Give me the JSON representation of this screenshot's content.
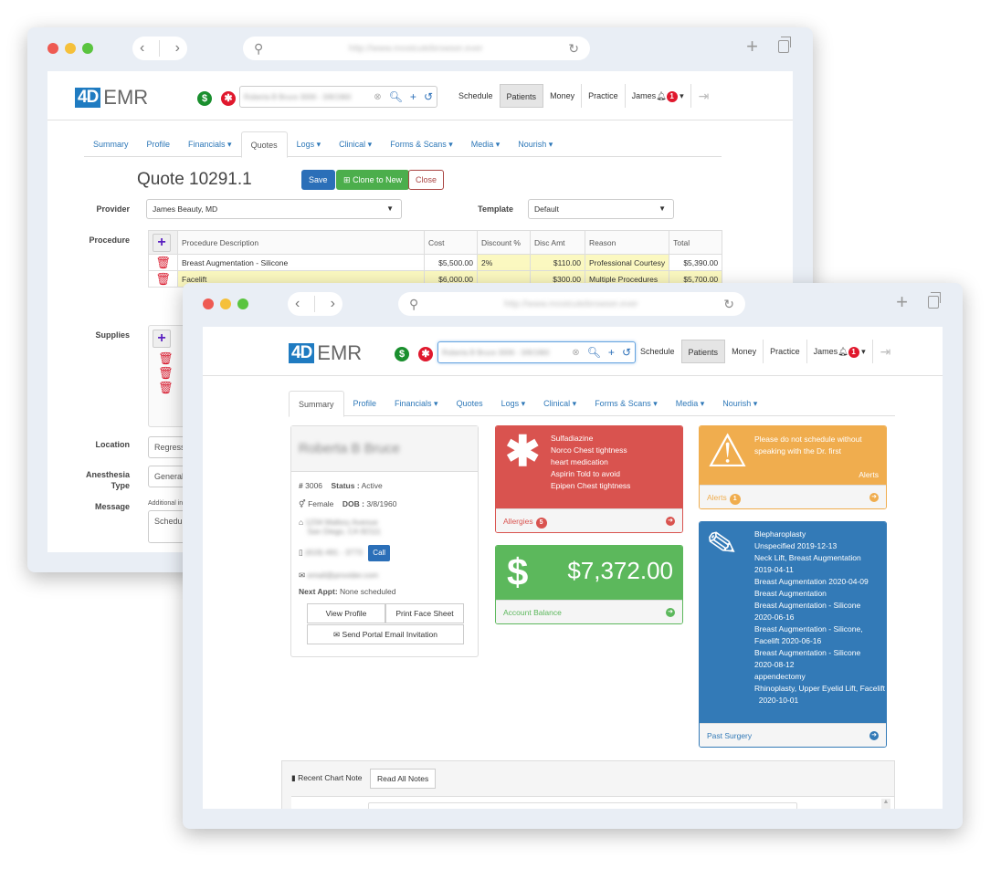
{
  "browser": {
    "url_placeholder": "http://www.mostcutebrowser.ever",
    "back_label": "‹",
    "forward_label": "›"
  },
  "app": {
    "logo_mark": "4D",
    "logo_text": "EMR",
    "money_icon": "$",
    "medical_icon": "✱",
    "search_value": "Roberta B Bruce 3006 - 3/8/1960",
    "nav": [
      "Schedule",
      "Patients",
      "Money",
      "Practice"
    ],
    "active_nav": "Patients",
    "user": "James",
    "notification_count": "1"
  },
  "patient_tabs": [
    "Summary",
    "Profile",
    "Financials ▾",
    "Quotes",
    "Logs ▾",
    "Clinical ▾",
    "Forms & Scans ▾",
    "Media ▾",
    "Nourish ▾"
  ],
  "quote": {
    "title": "Quote 10291.1",
    "save_label": "Save",
    "clone_label": "Clone to New",
    "close_label": "Close",
    "provider_label": "Provider",
    "provider_value": "James Beauty, MD",
    "template_label": "Template",
    "template_value": "Default",
    "procedure_label": "Procedure",
    "columns": [
      "Procedure Description",
      "Cost",
      "Discount %",
      "Disc Amt",
      "Reason",
      "Total"
    ],
    "rows": [
      {
        "description": "Breast Augmentation - Silicone",
        "cost": "$5,500.00",
        "discount_pct": "2%",
        "disc_amt": "$110.00",
        "reason": "Professional Courtesy",
        "total": "$5,390.00"
      },
      {
        "description": "Facelift",
        "cost": "$6,000.00",
        "discount_pct": "",
        "disc_amt": "$300.00",
        "reason": "Multiple Procedures",
        "total": "$5,700.00"
      }
    ],
    "supplies_label": "Supplies",
    "location_label": "Location",
    "location_value": "Regression",
    "anesthesia_label": "Anesthesia Type",
    "anesthesia_value": "General",
    "message_label": "Message",
    "message_hint": "Additional info",
    "message_value": "Schedule"
  },
  "summary": {
    "patient_name": "Roberta B Bruce",
    "id_label": "#",
    "id_value": "3006",
    "status_label": "Status :",
    "status_value": "Active",
    "gender": "Female",
    "dob_label": "DOB :",
    "dob_value": "3/8/1960",
    "address_line1": "1234 Mallory Avenue",
    "address_line2": "San Diego, CA 92111",
    "phone": "(619) 491 - 3773",
    "call_label": "Call",
    "email": "email@provider.com",
    "next_appt_label": "Next Appt:",
    "next_appt_value": "None scheduled",
    "view_profile_label": "View Profile",
    "print_face_sheet_label": "Print Face Sheet",
    "send_portal_label": "Send Portal Email Invitation"
  },
  "allergies": {
    "lines": [
      "Sulfadiazine",
      "Norco   Chest tightness",
      "heart medication",
      "Aspirin   Told to avoid",
      "Epipen   Chest tightness"
    ],
    "footer_label": "Allergies",
    "count": "5",
    "color": "#d9534f"
  },
  "balance": {
    "amount": "$7,372.00",
    "footer_label": "Account Balance",
    "color": "#5cb85c"
  },
  "alerts": {
    "message": "Please do not schedule without speaking with the Dr. first",
    "corner_label": "Alerts",
    "footer_label": "Alerts",
    "count": "1",
    "color": "#f0ad4e"
  },
  "past_surgery": {
    "lines": [
      "Blepharoplasty",
      "Unspecified   2019-12-13",
      "Neck Lift, Breast Augmentation",
      "2019-04-11",
      "Breast Augmentation   2020-04-09",
      "Breast Augmentation",
      "Breast Augmentation - Silicone",
      "2020-06-16",
      "Breast Augmentation - Silicone,",
      "Facelift   2020-06-16",
      "Breast Augmentation - Silicone",
      "2020-08-12",
      "appendectomy",
      "Rhinoplasty, Upper Eyelid Lift, Facelift",
      "  2020-10-01"
    ],
    "footer_label": "Past Surgery",
    "color": "#337ab7"
  },
  "notes": {
    "title": "Recent Chart Note",
    "read_all_label": "Read All Notes"
  }
}
